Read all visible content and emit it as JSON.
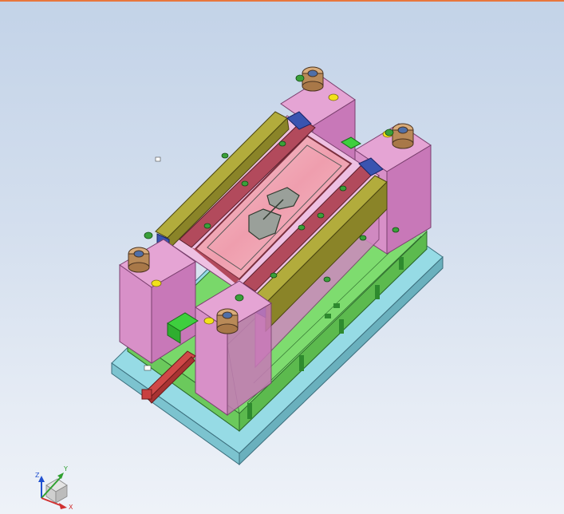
{
  "viewport": {
    "title": "",
    "background_top": "#c3d3e8",
    "background_bottom": "#eef2f8",
    "accent_border": "#e8773d"
  },
  "model": {
    "type": "injection-mould-assembly",
    "colors": {
      "base_plate": "#8fd6e0",
      "support_plates": "#6ecf62",
      "a_plate": "#e89ad0",
      "rails": "#8a8428",
      "cavity": "#f0b8c4",
      "core_insert": "#e8c8cf",
      "slider_blocks": "#3a54b0",
      "bushings": "#c89a6a",
      "screws": "#2e8a2e",
      "gate_block": "#3ecf3e",
      "cylinder": "#c84040"
    }
  },
  "triad": {
    "axes": [
      {
        "label": "Z",
        "color": "#2050d0"
      },
      {
        "label": "Y",
        "color": "#30a030"
      },
      {
        "label": "X",
        "color": "#d03030"
      }
    ],
    "cube_icon": "view-cube-icon"
  }
}
